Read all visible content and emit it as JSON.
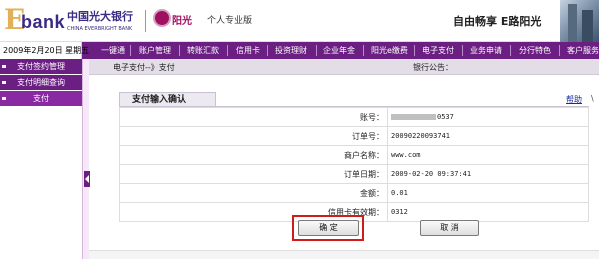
{
  "header": {
    "logo_e": "E",
    "logo_bank": "bank",
    "bank_name_cn": "中国光大银行",
    "bank_name_en": "CHINA EVERBRIGHT BANK",
    "brand": "阳光",
    "edition": "个人专业版",
    "slogan": "自由畅享 E路阳光"
  },
  "date": "2009年2月20日 星期五",
  "nav": {
    "items": [
      "一键通",
      "账户管理",
      "转账汇款",
      "信用卡",
      "投资理财",
      "企业年金",
      "阳光e缴费",
      "电子支付",
      "业务申请",
      "分行特色",
      "客户服务"
    ]
  },
  "sidebar": {
    "items": [
      {
        "label": "支付签约管理",
        "active": false
      },
      {
        "label": "支付明细查询",
        "active": false
      },
      {
        "label": "支付",
        "active": true
      }
    ]
  },
  "breadcrumb": {
    "text": "电子支付--》支付",
    "notice_label": "银行公告："
  },
  "panel": {
    "title": "支付输入确认",
    "help": "帮助",
    "help_extra": "\\"
  },
  "form": {
    "rows": [
      {
        "label": "账号：",
        "value": "0537",
        "masked": true
      },
      {
        "label": "订单号：",
        "value": "20090220093741"
      },
      {
        "label": "商户名称：",
        "value": "www.com"
      },
      {
        "label": "订单日期：",
        "value": "2009-02-20 09:37:41"
      },
      {
        "label": "金额：",
        "value": "0.01"
      },
      {
        "label": "信用卡有效期：",
        "value": "0312"
      }
    ]
  },
  "buttons": {
    "confirm": "确 定",
    "cancel": "取 消"
  },
  "colors": {
    "nav_purple": "#6b1f82",
    "logo_gold": "#e3b05a",
    "logo_navy": "#3b2a86",
    "highlight_red": "#d21a1a",
    "link_blue": "#1a2b9c"
  }
}
